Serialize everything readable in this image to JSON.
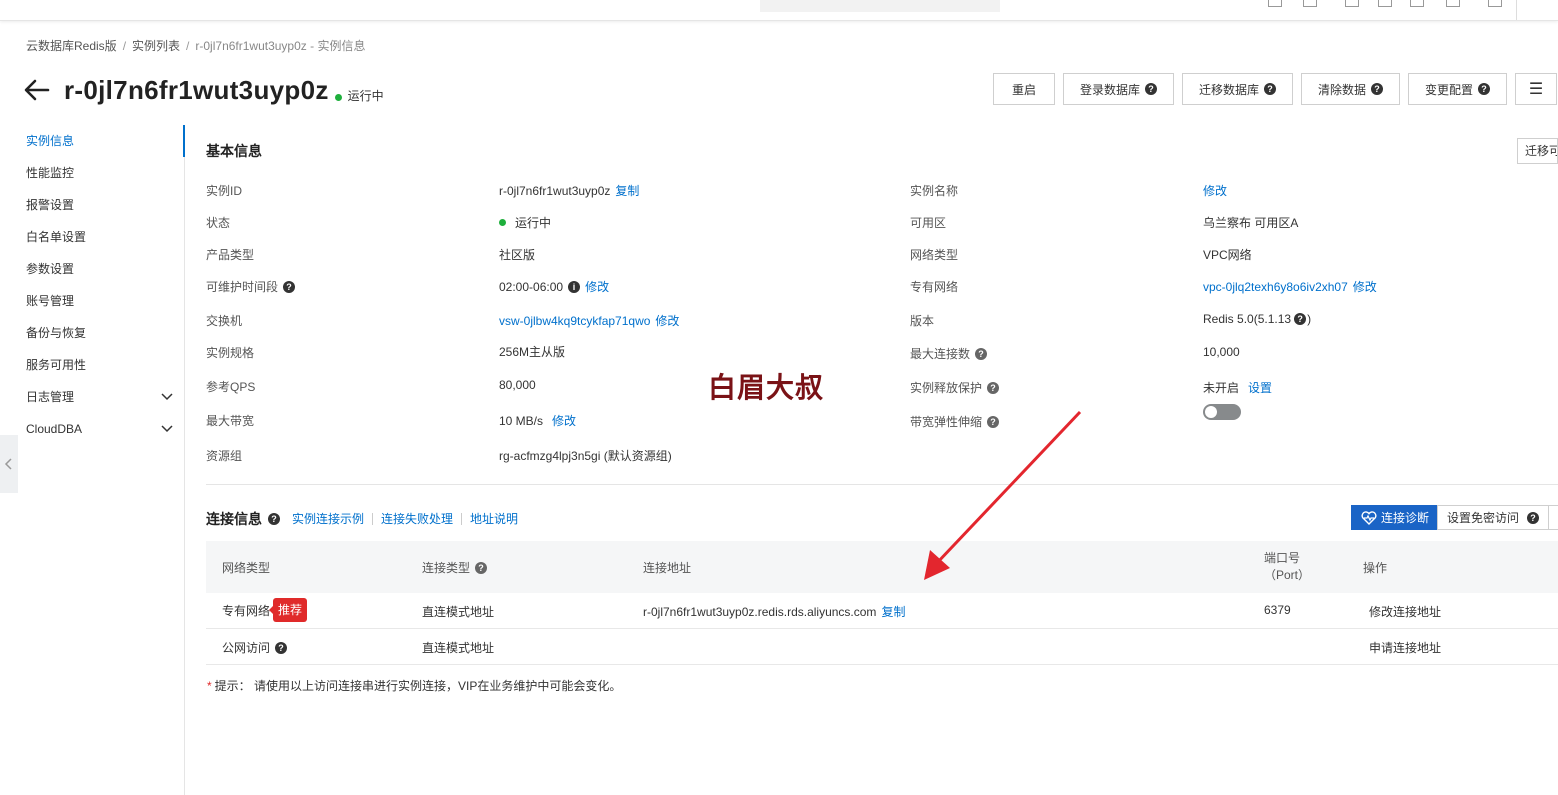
{
  "breadcrumb": {
    "items": [
      "云数据库Redis版",
      "实例列表"
    ],
    "current": "r-0jl7n6fr1wut3uyp0z - 实例信息",
    "separator": "/"
  },
  "header": {
    "title": "r-0jl7n6fr1wut3uyp0z",
    "status": "运行中",
    "status_color": "#1eaf3c"
  },
  "actions": {
    "restart": "重启",
    "login_db": "登录数据库",
    "migrate_db": "迁移数据库",
    "clear_data": "清除数据",
    "change_config": "变更配置",
    "menu_glyph": "☰"
  },
  "sidebar": {
    "items": [
      {
        "label": "实例信息"
      },
      {
        "label": "性能监控"
      },
      {
        "label": "报警设置"
      },
      {
        "label": "白名单设置"
      },
      {
        "label": "参数设置"
      },
      {
        "label": "账号管理"
      },
      {
        "label": "备份与恢复"
      },
      {
        "label": "服务可用性"
      },
      {
        "label": "日志管理"
      },
      {
        "label": "CloudDBA"
      }
    ]
  },
  "basic": {
    "title": "基本信息",
    "migrate_btn": "迁移可",
    "left": [
      {
        "label": "实例ID",
        "value": "r-0jl7n6fr1wut3uyp0z",
        "link": "复制"
      },
      {
        "label": "状态",
        "value": "运行中"
      },
      {
        "label": "产品类型",
        "value": "社区版"
      },
      {
        "label": "可维护时间段",
        "value": "02:00-06:00",
        "link": "修改"
      },
      {
        "label": "交换机",
        "value": "vsw-0jlbw4kq9tcykfap71qwo",
        "link": "修改"
      },
      {
        "label": "实例规格",
        "value": "256M主从版"
      },
      {
        "label": "参考QPS",
        "value": "80,000"
      },
      {
        "label": "最大带宽",
        "value": "10 MB/s",
        "link": "修改"
      },
      {
        "label": "资源组",
        "value": "rg-acfmzg4lpj3n5gi (默认资源组)"
      }
    ],
    "right": [
      {
        "label": "实例名称",
        "link": "修改"
      },
      {
        "label": "可用区",
        "value": "乌兰察布 可用区A"
      },
      {
        "label": "网络类型",
        "value": "VPC网络"
      },
      {
        "label": "专有网络",
        "value": "vpc-0jlq2texh6y8o6iv2xh07",
        "link": "修改"
      },
      {
        "label": "版本",
        "value": "Redis 5.0(5.1.13",
        "suffix": ")"
      },
      {
        "label": "最大连接数",
        "value": "10,000"
      },
      {
        "label": "实例释放保护",
        "value": "未开启",
        "link": "设置"
      },
      {
        "label": "带宽弹性伸缩",
        "toggle_on": false
      }
    ]
  },
  "connection": {
    "title": "连接信息",
    "links": [
      "实例连接示例",
      "连接失败处理",
      "地址说明"
    ],
    "diag_btn": "连接诊断",
    "nopass_btn": "设置免密访问",
    "headers": {
      "net_type": "网络类型",
      "conn_type": "连接类型",
      "address": "连接地址",
      "port_line1": "端口号",
      "port_line2": "（Port）",
      "ops": "操作"
    },
    "rows": [
      {
        "net_type": "专有网络",
        "badge": "推荐",
        "conn_type": "直连模式地址",
        "address": "r-0jl7n6fr1wut3uyp0z.redis.rds.aliyuncs.com",
        "copy": "复制",
        "port": "6379",
        "op": "修改连接地址"
      },
      {
        "net_type": "公网访问",
        "conn_type": "直连模式地址",
        "address": "",
        "port": "",
        "op": "申请连接地址"
      }
    ],
    "tip_label": "提示：",
    "tip_text": "请使用以上访问连接串进行实例连接，VIP在业务维护中可能会变化。"
  },
  "watermark": "白眉大叔",
  "colors": {
    "link": "#0070cc",
    "primary_button": "#1a64c6",
    "badge": "#e02a2a",
    "annotation_arrow": "#e3262e",
    "watermark": "#7a1216"
  }
}
